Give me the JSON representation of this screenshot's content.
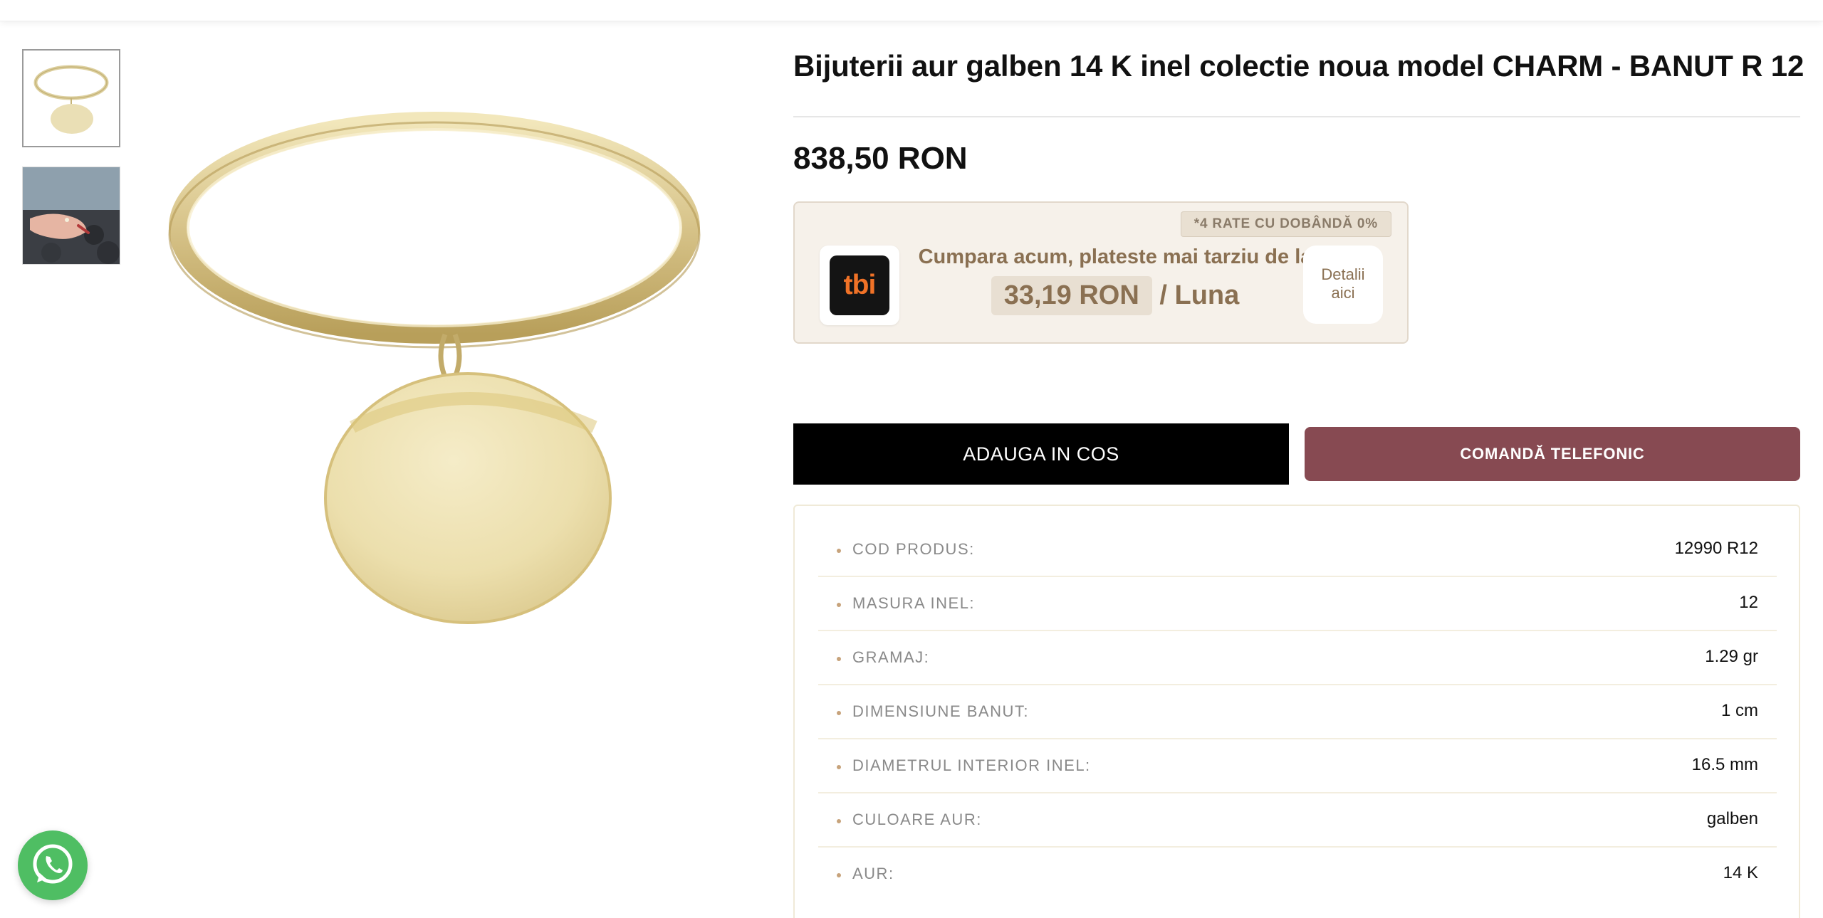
{
  "product": {
    "title": "Bijuterii aur galben 14 K inel colectie noua model CHARM - BANUT R 12",
    "price": "838,50 RON",
    "images": [
      {
        "name": "ring-with-coin-charm"
      },
      {
        "name": "ring-on-hand-photo"
      }
    ]
  },
  "tbi": {
    "badge": "*4 RATE CU DOBÂNDĂ 0%",
    "logo_text": "tbi",
    "line1": "Cumpara acum, plateste mai tarziu de la",
    "amount": "33,19 RON",
    "per_month": " / Luna",
    "details_line1": "Detalii",
    "details_line2": "aici"
  },
  "buttons": {
    "add_to_cart": "ADAUGA IN COS",
    "order_phone": "COMANDĂ TELEFONIC"
  },
  "specs": [
    {
      "label": "COD PRODUS:",
      "value": "12990 R12"
    },
    {
      "label": "MASURA INEL:",
      "value": "12"
    },
    {
      "label": "GRAMAJ:",
      "value": "1.29 gr"
    },
    {
      "label": "DIMENSIUNE BANUT:",
      "value": "1 cm"
    },
    {
      "label": "DIAMETRUL INTERIOR INEL:",
      "value": "16.5 mm"
    },
    {
      "label": "CULOARE AUR:",
      "value": "galben"
    },
    {
      "label": "AUR:",
      "value": "14 K"
    }
  ],
  "colors": {
    "accent_phone_button": "#874a52",
    "tbi_orange": "#f07227",
    "whatsapp_green": "#4fbe63",
    "gold": "#e8d9a0"
  },
  "icons": {
    "whatsapp": "whatsapp-icon"
  }
}
